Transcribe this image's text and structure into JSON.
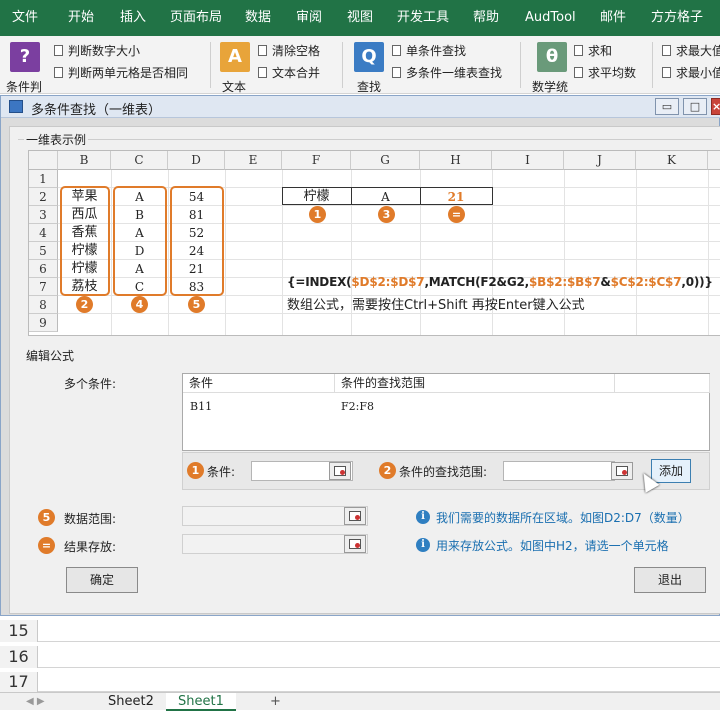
{
  "ribbon_tabs": [
    "文件",
    "开始",
    "插入",
    "页面布局",
    "数据",
    "审阅",
    "视图",
    "开发工具",
    "帮助",
    "AudTool",
    "邮件",
    "方方格子"
  ],
  "ribbon": {
    "big": [
      {
        "label": "条件判",
        "icon": "question-icon",
        "glyph": "?",
        "color": "#7b3fa0"
      },
      {
        "label": "文本",
        "icon": "text-icon",
        "glyph": "A",
        "color": "#e8a43a"
      },
      {
        "label": "查找",
        "icon": "find-icon",
        "glyph": "Q",
        "color": "#3b7cc4"
      },
      {
        "label": "数学统",
        "icon": "theta-icon",
        "glyph": "θ",
        "color": "#6a9a7a"
      }
    ],
    "items": [
      "判断数字大小",
      "判断两单元格是否相同",
      "清除空格",
      "文本合并",
      "单条件查找",
      "多条件一维表查找",
      "求和",
      "求平均数",
      "求最大值",
      "求最小值"
    ]
  },
  "dialog": {
    "title": "多条件查找（一维表）",
    "section_example": "一维表示例",
    "section_edit": "编辑公式",
    "columns": [
      "B",
      "C",
      "D",
      "E",
      "F",
      "G",
      "H",
      "I",
      "J",
      "K"
    ],
    "rows": [
      "1",
      "2",
      "3",
      "4",
      "5",
      "6",
      "7",
      "8",
      "9"
    ],
    "col_b": [
      "苹果",
      "西瓜",
      "香蕉",
      "柠檬",
      "柠檬",
      "荔枝"
    ],
    "col_c": [
      "A",
      "B",
      "A",
      "D",
      "A",
      "C"
    ],
    "col_d": [
      "54",
      "81",
      "52",
      "24",
      "21",
      "83"
    ],
    "lookup": {
      "f2": "柠檬",
      "g2": "A",
      "h2": "21"
    },
    "badges": {
      "one": "1",
      "two": "2",
      "three": "3",
      "four": "4",
      "five": "5",
      "eq": "="
    },
    "formula": {
      "p1": "{=INDEX(",
      "p2": "$D$2:$D$7",
      "p3": ",MATCH(F2&G2,",
      "p4": "$B$2:$B$7",
      "p5": "&",
      "p6": "$C$2:$C$7",
      "p7": ",0))}"
    },
    "formula_note": "数组公式，需要按住Ctrl+Shift 再按Enter键入公式",
    "multi_label": "多个条件:",
    "list_headers": [
      "条件",
      "条件的查找范围"
    ],
    "list_row": {
      "cond": "B11",
      "range": "F2:F8"
    },
    "cond_label": "条件:",
    "range_label": "条件的查找范围:",
    "add_button": "添加",
    "data_range_label": "数据范围:",
    "data_range_hint": "我们需要的数据所在区域。如图D2:D7（数量）",
    "result_label": "结果存放:",
    "result_hint": "用来存放公式。如图中H2，请选一个单元格",
    "ok_button": "确定",
    "exit_button": "退出",
    "window_controls": [
      "▭",
      "□",
      "×"
    ]
  },
  "excel_rows": [
    "15",
    "16",
    "17"
  ],
  "sheet_tabs": [
    "Sheet2",
    "Sheet1"
  ],
  "sheet_nav": "◀  ▶",
  "add_sheet": "+"
}
